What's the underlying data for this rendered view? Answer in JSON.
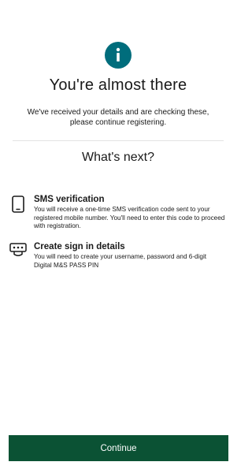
{
  "header": {
    "info_icon": "info-icon",
    "title": "You're almost there",
    "subtitle": "We've received your details and are checking these, please continue registering."
  },
  "colors": {
    "brand_green": "#0b5234",
    "info_teal": "#006d7c",
    "text": "#1a1a1a",
    "divider": "#e3e3e3"
  },
  "next": {
    "heading": "What's next?",
    "steps": [
      {
        "icon": "smartphone-icon",
        "title": "SMS verification",
        "text": "You will receive a one-time SMS verification code sent to your registered mobile number. You'll need to enter this code to proceed with registration."
      },
      {
        "icon": "password-icon",
        "title": "Create sign in details",
        "text": "You will need to create your username, password and 6-digit Digital M&S PASS PIN"
      }
    ]
  },
  "footer": {
    "continue_label": "Continue"
  }
}
